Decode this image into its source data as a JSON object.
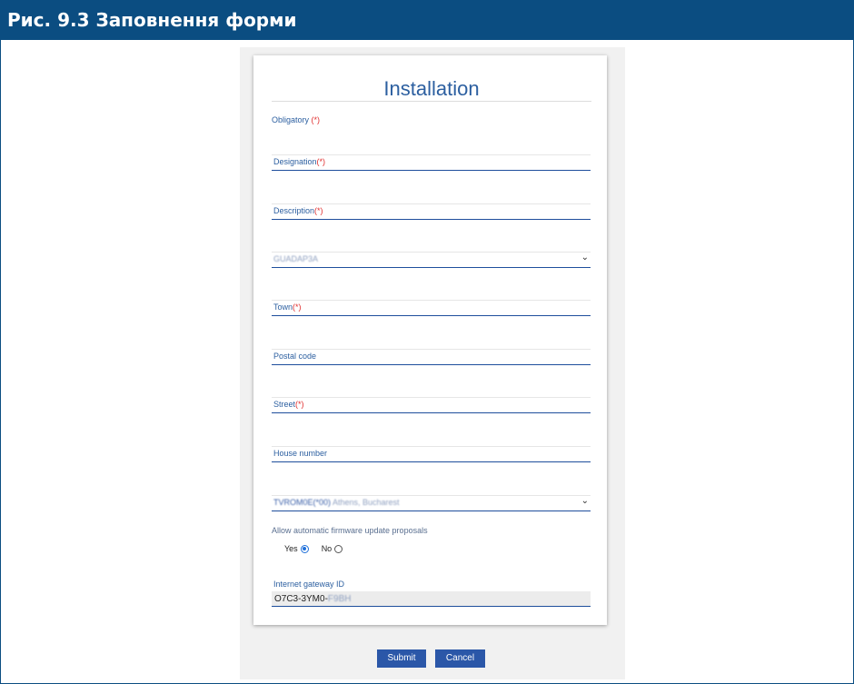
{
  "banner": {
    "title": "Рис. 9.3 Заповнення форми"
  },
  "form": {
    "title": "Installation",
    "obligatory_label": "Obligatory ",
    "required_mark": "(*)",
    "fields": {
      "designation": "Designation",
      "description": "Description",
      "country": "GUADAP3A",
      "town": "Town",
      "postal_code": "Postal code",
      "street": "Street",
      "house_number": "House number",
      "timezone_prefix": "TVROM0E(*00)",
      "timezone_suffix": " Athens, Bucharest"
    },
    "auto_update": {
      "label": "Allow automatic firmware update proposals",
      "yes": "Yes",
      "no": "No",
      "selected": "Yes"
    },
    "gateway": {
      "label": "Internet gateway ID",
      "value_visible": "O7C3-3YM0-",
      "value_blurred": "F9BH"
    }
  },
  "buttons": {
    "submit": "Submit",
    "cancel": "Cancel"
  },
  "colors": {
    "banner": "#0b4d81",
    "accent": "#2c5fa0",
    "required": "#e03030",
    "button": "#2b57a8"
  }
}
